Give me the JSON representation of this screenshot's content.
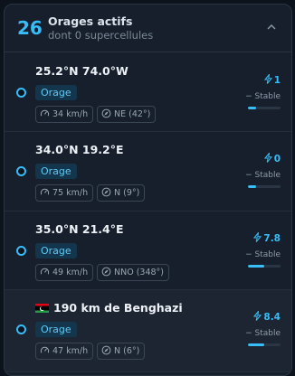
{
  "header": {
    "count": "26",
    "title": "Orages actifs",
    "subtitle": "dont 0 supercellules",
    "collapse_icon": "chevron-up-icon"
  },
  "storms": [
    {
      "location": "25.2°N 74.0°W",
      "type": "Orage",
      "speed": "34 km/h",
      "direction": "NE (42°)",
      "lightning": "1",
      "trend": "− Stable",
      "intensity_fraction": 0.25,
      "flag": null
    },
    {
      "location": "34.0°N 19.2°E",
      "type": "Orage",
      "speed": "75 km/h",
      "direction": "N (9°)",
      "lightning": "0",
      "trend": "− Stable",
      "intensity_fraction": 0.25,
      "flag": null
    },
    {
      "location": "35.0°N 21.4°E",
      "type": "Orage",
      "speed": "49 km/h",
      "direction": "NNO (348°)",
      "lightning": "7.8",
      "trend": "− Stable",
      "intensity_fraction": 0.5,
      "flag": null
    },
    {
      "location": "190 km de Benghazi",
      "type": "Orage",
      "speed": "47 km/h",
      "direction": "N (6°)",
      "lightning": "8.4",
      "trend": "− Stable",
      "intensity_fraction": 0.5,
      "flag": "libya-flag-icon"
    }
  ],
  "colors": {
    "accent": "#38bdf8",
    "background": "#0d131c",
    "panel": "#161f2b",
    "tag_bg": "#14364d"
  }
}
